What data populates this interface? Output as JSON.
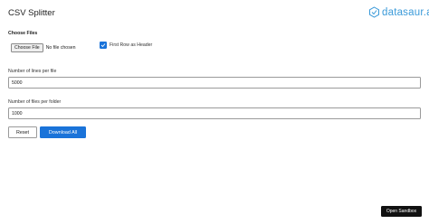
{
  "app": {
    "title": "CSV Splitter"
  },
  "logo": {
    "text": "datasaur.ai"
  },
  "choose_files": {
    "label": "Choose Files",
    "button_label": "Choose File",
    "status": "No file chosen"
  },
  "header_option": {
    "label": "First Row as Header",
    "checked": true
  },
  "lines_per_file": {
    "label": "Number of lines per file",
    "value": "5000"
  },
  "files_per_folder": {
    "label": "Number of files per folder",
    "value": "1000"
  },
  "actions": {
    "reset_label": "Reset",
    "download_label": "Download All"
  },
  "sandbox": {
    "label": "Open Sandbox"
  },
  "colors": {
    "accent": "#1a73d9",
    "logo": "#3a9ad9",
    "sandbox_bg": "#111111"
  }
}
